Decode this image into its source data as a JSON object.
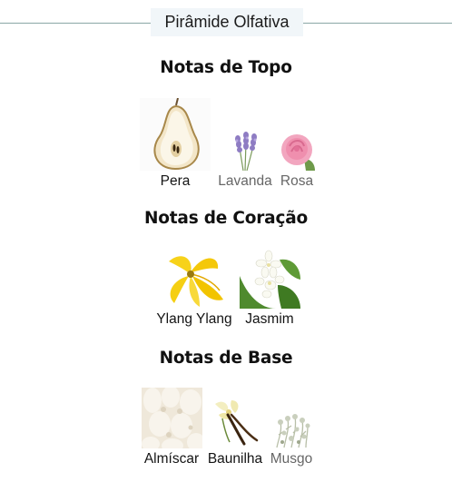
{
  "header": {
    "title": "Pirâmide Olfativa"
  },
  "sections": [
    {
      "title": "Notas de Topo",
      "notes": [
        {
          "label": "Pera",
          "icon": "pear-icon"
        },
        {
          "label": "Lavanda",
          "icon": "lavender-icon"
        },
        {
          "label": "Rosa",
          "icon": "rose-icon"
        }
      ]
    },
    {
      "title": "Notas de Coração",
      "notes": [
        {
          "label": "Ylang Ylang",
          "icon": "ylang-ylang-icon"
        },
        {
          "label": "Jasmim",
          "icon": "jasmine-icon"
        }
      ]
    },
    {
      "title": "Notas de Base",
      "notes": [
        {
          "label": "Almíscar",
          "icon": "musk-icon"
        },
        {
          "label": "Baunilha",
          "icon": "vanilla-icon"
        },
        {
          "label": "Musgo",
          "icon": "moss-icon"
        }
      ]
    }
  ],
  "colors": {
    "header_line": "#8aa7a6",
    "header_bg": "#f1f6f9"
  }
}
